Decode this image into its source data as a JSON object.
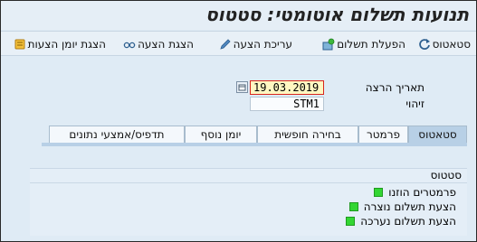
{
  "window": {
    "title": "תנועות תשלום אוטומטי: סטטוס"
  },
  "toolbar": {
    "items": [
      {
        "label": "סטאטוס",
        "icon": "refresh-icon"
      },
      {
        "label": "הפעלת תשלום",
        "icon": "execute-payment-icon"
      },
      {
        "label": "עריכת הצעה",
        "icon": "pencil-icon"
      },
      {
        "label": "הצגת הצעה",
        "icon": "glasses-icon"
      },
      {
        "label": "הצגת יומן הצעות",
        "icon": "scroll-icon"
      }
    ]
  },
  "form": {
    "run_date_label": "תאריך הרצה",
    "run_date_value": "19.03.2019",
    "id_label": "זיהוי",
    "id_value": "STM1"
  },
  "tabs": [
    {
      "label": "סטאטוס",
      "active": true
    },
    {
      "label": "פרמטר",
      "active": false
    },
    {
      "label": "בחירה חופשית",
      "active": false
    },
    {
      "label": "יומן נוסף",
      "active": false
    },
    {
      "label": "תדפיס/אמצעי נתונים",
      "active": false
    }
  ],
  "status_group": {
    "title": "סטטוס",
    "items": [
      {
        "label": "פרמטרים הוזנו",
        "state": "green"
      },
      {
        "label": "הצעת תשלום נוצרה",
        "state": "green"
      },
      {
        "label": "הצעת תשלום נערכה",
        "state": "green"
      }
    ]
  },
  "colors": {
    "status_green": "#33d633",
    "active_tab": "#b8d0e6",
    "required_field_border": "#d9261c"
  }
}
